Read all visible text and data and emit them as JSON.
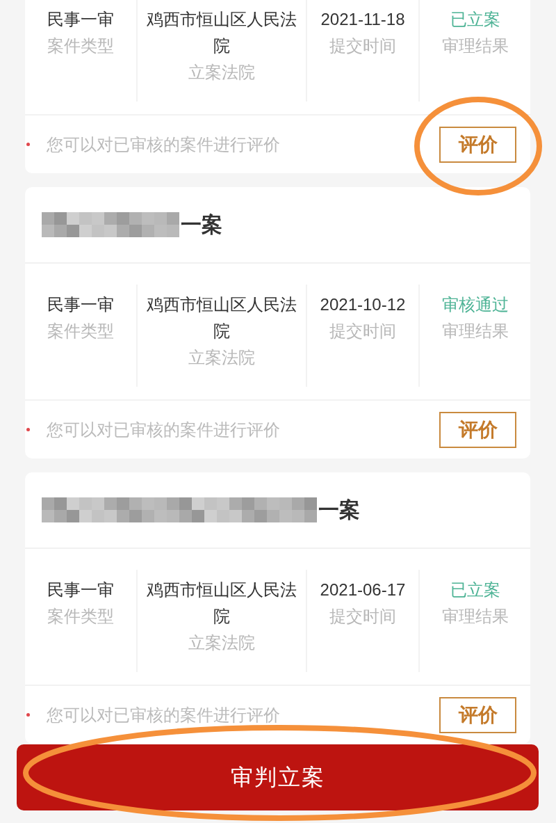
{
  "cases": [
    {
      "info": [
        {
          "kind": "text",
          "value": "民事一审",
          "label": "案件类型"
        },
        {
          "kind": "text",
          "value": "鸡西市恒山区人民法院",
          "label": "立案法院"
        },
        {
          "kind": "text",
          "value": "2021-11-18",
          "label": "提交时间"
        },
        {
          "kind": "status",
          "value": "已立案",
          "label": "审理结果"
        }
      ],
      "hint": "您可以对已审核的案件进行评价",
      "rate_button": {
        "label": "评价",
        "highlighted": true
      }
    },
    {
      "title": {
        "kind": "short",
        "text": "一案"
      },
      "info": [
        {
          "kind": "text",
          "value": "民事一审",
          "label": "案件类型"
        },
        {
          "kind": "text",
          "value": "鸡西市恒山区人民法院",
          "label": "立案法院"
        },
        {
          "kind": "text",
          "value": "2021-10-12",
          "label": "提交时间"
        },
        {
          "kind": "status",
          "value": "审核通过",
          "label": "审理结果"
        }
      ],
      "hint": "您可以对已审核的案件进行评价",
      "rate_button": {
        "label": "评价",
        "highlighted": false
      }
    },
    {
      "title": {
        "kind": "long",
        "text": "一案"
      },
      "info": [
        {
          "kind": "text",
          "value": "民事一审",
          "label": "案件类型"
        },
        {
          "kind": "text",
          "value": "鸡西市恒山区人民法院",
          "label": "立案法院"
        },
        {
          "kind": "text",
          "value": "2021-06-17",
          "label": "提交时间"
        },
        {
          "kind": "status",
          "value": "已立案",
          "label": "审理结果"
        }
      ],
      "hint": "您可以对已审核的案件进行评价",
      "rate_button": {
        "label": "评价",
        "highlighted": false
      }
    }
  ],
  "bottom_button": {
    "label": "审判立案",
    "highlighted": true
  }
}
